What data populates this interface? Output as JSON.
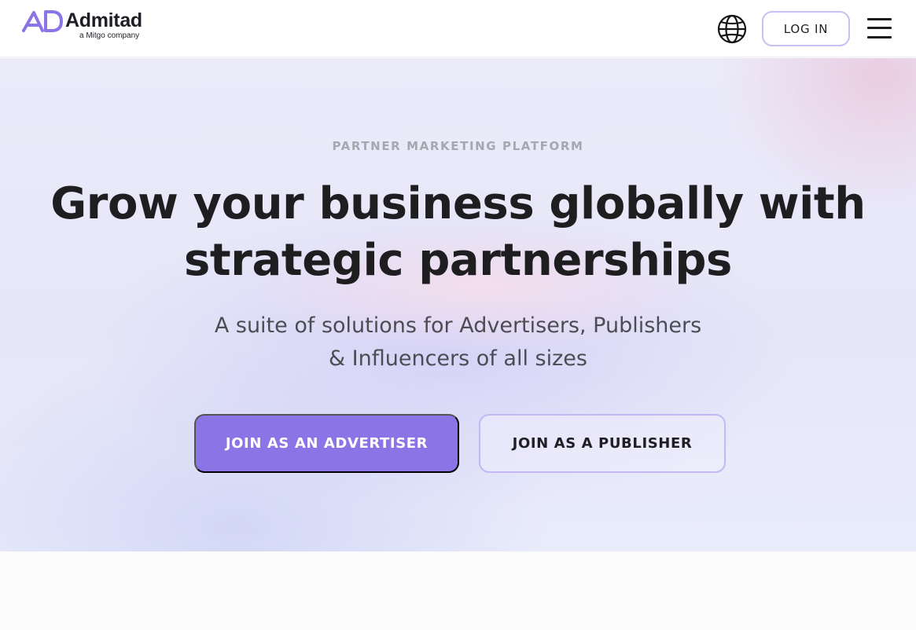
{
  "header": {
    "logo_name": "Admitad",
    "logo_sub": "a Mitgo company",
    "globe_icon": "globe-icon",
    "login_label": "LOG IN",
    "menu_icon": "hamburger-menu-icon"
  },
  "hero": {
    "eyebrow": "PARTNER MARKETING PLATFORM",
    "headline_line1": "Grow your business globally with",
    "headline_line2": "strategic partnerships",
    "subhead_line1": "A suite of solutions for Advertisers, Publishers",
    "subhead_line2": "& Influencers of all sizes",
    "advertiser_button": "JOIN AS AN ADVERTISER",
    "publisher_button": "JOIN AS A PUBLISHER"
  },
  "colors": {
    "accent": "#8b74e6",
    "accent_border": "#c3b8f3",
    "text_dark": "#1e1e21",
    "eyebrow_gray": "#a7a7af"
  }
}
